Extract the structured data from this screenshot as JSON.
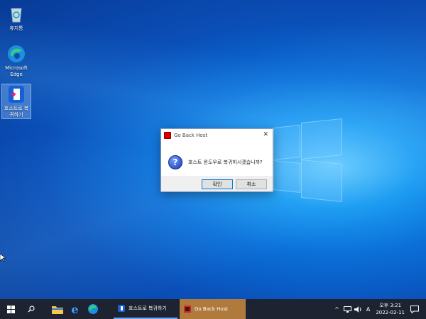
{
  "desktop": {
    "icons": [
      {
        "label": "휴지통"
      },
      {
        "label": "Microsoft Edge"
      },
      {
        "label": "호스트로 복귀하기"
      }
    ]
  },
  "dialog": {
    "title": "Go Back Host",
    "close": "✕",
    "message": "호스트 윈도우로 복귀하시겠습니까?",
    "ok_label": "확인",
    "cancel_label": "취소"
  },
  "taskbar": {
    "tasks": [
      {
        "label": "호스트로 복귀하기"
      },
      {
        "label": "Go Back Host"
      }
    ],
    "tray": {
      "chevron": "^",
      "ime": "A",
      "time": "오후 3:21",
      "date": "2022-02-11"
    }
  }
}
